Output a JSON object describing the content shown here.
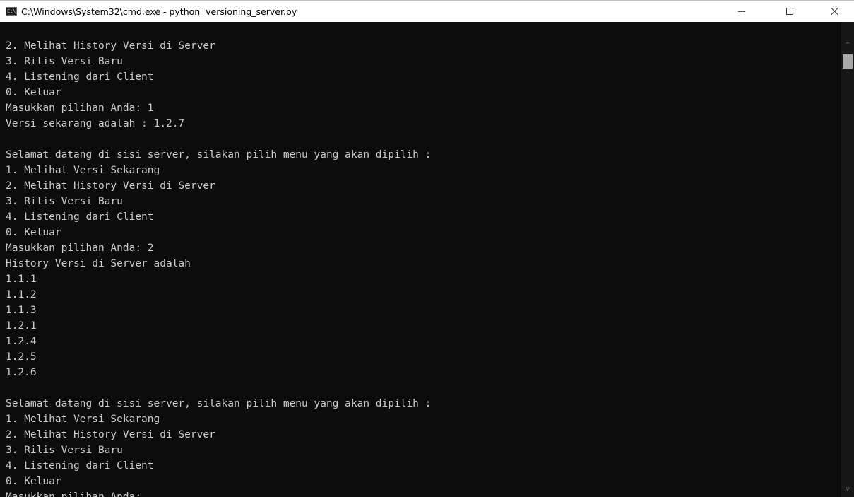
{
  "window": {
    "icon_label": "C:\\",
    "title": "C:\\Windows\\System32\\cmd.exe - python  versioning_server.py",
    "minimize_glyph": "—",
    "maximize_glyph": "☐",
    "close_glyph": "✕"
  },
  "scrollbar": {
    "up_glyph": "^",
    "down_glyph": "v",
    "thumb_position_fraction": 0.0
  },
  "console": {
    "lines": [
      "2. Melihat History Versi di Server",
      "3. Rilis Versi Baru",
      "4. Listening dari Client",
      "0. Keluar",
      "Masukkan pilihan Anda: 1",
      "Versi sekarang adalah : 1.2.7",
      "",
      "Selamat datang di sisi server, silakan pilih menu yang akan dipilih :",
      "1. Melihat Versi Sekarang",
      "2. Melihat History Versi di Server",
      "3. Rilis Versi Baru",
      "4. Listening dari Client",
      "0. Keluar",
      "Masukkan pilihan Anda: 2",
      "History Versi di Server adalah",
      "1.1.1",
      "1.1.2",
      "1.1.3",
      "1.2.1",
      "1.2.4",
      "1.2.5",
      "1.2.6",
      "",
      "Selamat datang di sisi server, silakan pilih menu yang akan dipilih :",
      "1. Melihat Versi Sekarang",
      "2. Melihat History Versi di Server",
      "3. Rilis Versi Baru",
      "4. Listening dari Client",
      "0. Keluar",
      "Masukkan pilihan Anda:"
    ]
  },
  "colors": {
    "console_background": "#0c0c0c",
    "console_text": "#cccccc",
    "titlebar_background": "#ffffff"
  }
}
